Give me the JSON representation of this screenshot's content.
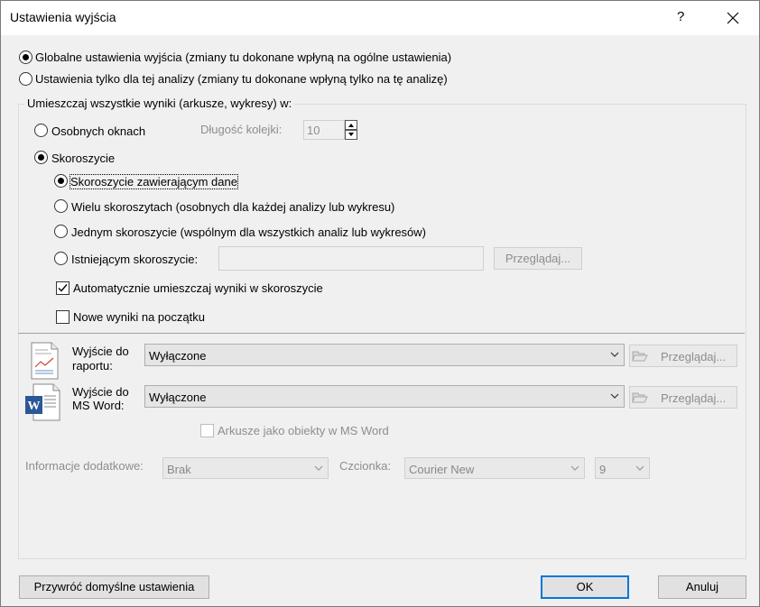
{
  "window": {
    "title": "Ustawienia wyjścia",
    "help": "?"
  },
  "scope": {
    "global_label": "Globalne ustawienia wyjścia (zmiany tu dokonane wpłyną na ogólne ustawienia)",
    "local_label": "Ustawienia tylko dla tej analizy (zmiany tu dokonane wpłyną tylko na tę analizę)"
  },
  "placement": {
    "group_label": "Umieszczaj wszystkie wyniki (arkusze, wykresy) w:",
    "separate_windows_label": "Osobnych oknach",
    "queue_length_label": "Długość kolejki:",
    "queue_length_value": "10",
    "workbook_label": "Skoroszycie",
    "wb_data_label": "Skoroszycie zawierającym dane",
    "wb_multiple_label": "Wielu skoroszytach (osobnych dla każdej analizy lub wykresu)",
    "wb_single_label": "Jednym skoroszycie (wspólnym dla wszystkich analiz lub wykresów)",
    "wb_existing_label": "Istniejącym skoroszycie:",
    "wb_existing_value": "",
    "browse_label": "Przeglądaj...",
    "auto_place_label": "Automatycznie umieszczaj wyniki w skoroszycie",
    "new_at_start_label": "Nowe wyniki na początku"
  },
  "report": {
    "label_line1": "Wyjście do",
    "label_line2": "raportu:",
    "value": "Wyłączone",
    "browse_label": "Przeglądaj..."
  },
  "word": {
    "label_line1": "Wyjście do",
    "label_line2": "MS Word:",
    "value": "Wyłączone",
    "browse_label": "Przeglądaj...",
    "sheets_as_objects_label": "Arkusze jako obiekty w MS Word"
  },
  "extra": {
    "info_label": "Informacje dodatkowe:",
    "info_value": "Brak",
    "font_label": "Czcionka:",
    "font_value": "Courier New",
    "size_value": "9"
  },
  "footer": {
    "restore_label": "Przywróć domyślne ustawienia",
    "ok_label": "OK",
    "cancel_label": "Anuluj"
  },
  "colors": {
    "accent": "#0078d7",
    "disabled_text": "#8d8d8d"
  }
}
